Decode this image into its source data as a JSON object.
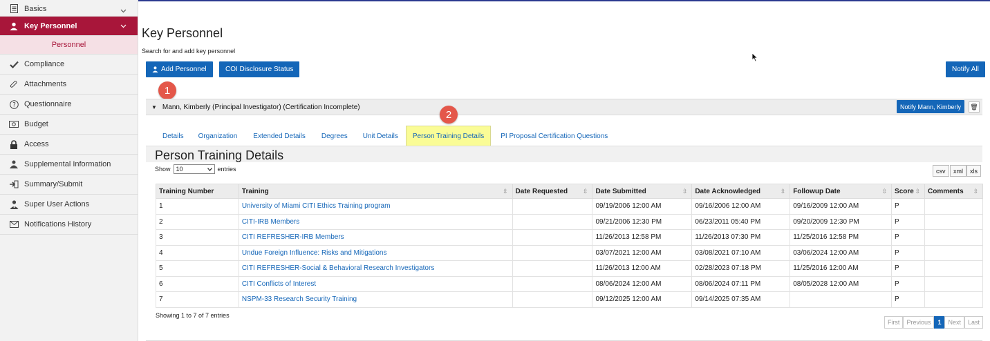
{
  "sidebar": {
    "items": [
      {
        "label": "Basics"
      },
      {
        "label": "Key Personnel"
      },
      {
        "label": "Personnel"
      },
      {
        "label": "Compliance"
      },
      {
        "label": "Attachments"
      },
      {
        "label": "Questionnaire"
      },
      {
        "label": "Budget"
      },
      {
        "label": "Access"
      },
      {
        "label": "Supplemental Information"
      },
      {
        "label": "Summary/Submit"
      },
      {
        "label": "Super User Actions"
      },
      {
        "label": "Notifications History"
      }
    ]
  },
  "header": {
    "title": "Key Personnel",
    "subtitle": "Search for and add key personnel",
    "add_personnel": "Add Personnel",
    "coi_status": "COI Disclosure Status",
    "notify_all": "Notify All"
  },
  "badges": {
    "one": "1",
    "two": "2"
  },
  "person": {
    "name": "Mann, Kimberly (Principal Investigator) (Certification Incomplete)",
    "notify": "Notify Mann, Kimberly",
    "delete_icon": "🗑"
  },
  "tabs": [
    {
      "label": "Details"
    },
    {
      "label": "Organization"
    },
    {
      "label": "Extended Details"
    },
    {
      "label": "Degrees"
    },
    {
      "label": "Unit Details"
    },
    {
      "label": "Person Training Details"
    },
    {
      "label": "PI Proposal Certification Questions"
    }
  ],
  "section": {
    "title": "Person Training Details",
    "show": "Show",
    "entries_value": "10",
    "entries": "entries",
    "csv": "csv",
    "xml": "xml",
    "xls": "xls"
  },
  "table": {
    "headers": [
      "Training Number",
      "Training",
      "Date Requested",
      "Date Submitted",
      "Date Acknowledged",
      "Followup Date",
      "Score",
      "Comments"
    ],
    "rows": [
      [
        "1",
        "University of Miami CITI Ethics Training program",
        "",
        "09/19/2006 12:00 AM",
        "09/16/2006 12:00 AM",
        "09/16/2009 12:00 AM",
        "P",
        ""
      ],
      [
        "2",
        "CITI-IRB Members",
        "",
        "09/21/2006 12:30 PM",
        "06/23/2011 05:40 PM",
        "09/20/2009 12:30 PM",
        "P",
        ""
      ],
      [
        "3",
        "CITI REFRESHER-IRB Members",
        "",
        "11/26/2013 12:58 PM",
        "11/26/2013 07:30 PM",
        "11/25/2016 12:58 PM",
        "P",
        ""
      ],
      [
        "4",
        "Undue Foreign Influence: Risks and Mitigations",
        "",
        "03/07/2021 12:00 AM",
        "03/08/2021 07:10 AM",
        "03/06/2024 12:00 AM",
        "P",
        ""
      ],
      [
        "5",
        "CITI REFRESHER-Social & Behavioral Research Investigators",
        "",
        "11/26/2013 12:00 AM",
        "02/28/2023 07:18 PM",
        "11/25/2016 12:00 AM",
        "P",
        ""
      ],
      [
        "6",
        "CITI Conflicts of Interest",
        "",
        "08/06/2024 12:00 AM",
        "08/06/2024 07:11 PM",
        "08/05/2028 12:00 AM",
        "P",
        ""
      ],
      [
        "7",
        "NSPM-33 Research Security Training",
        "",
        "09/12/2025 12:00 AM",
        "09/14/2025 07:35 AM",
        "",
        "P",
        ""
      ]
    ]
  },
  "footer": {
    "info": "Showing 1 to 7 of 7 entries",
    "first": "First",
    "previous": "Previous",
    "page": "1",
    "next": "Next",
    "last": "Last"
  },
  "colors": {
    "brand": "#a8163a",
    "primary": "#1466b8",
    "highlight": "#fafc96",
    "badge": "#e4574a"
  }
}
